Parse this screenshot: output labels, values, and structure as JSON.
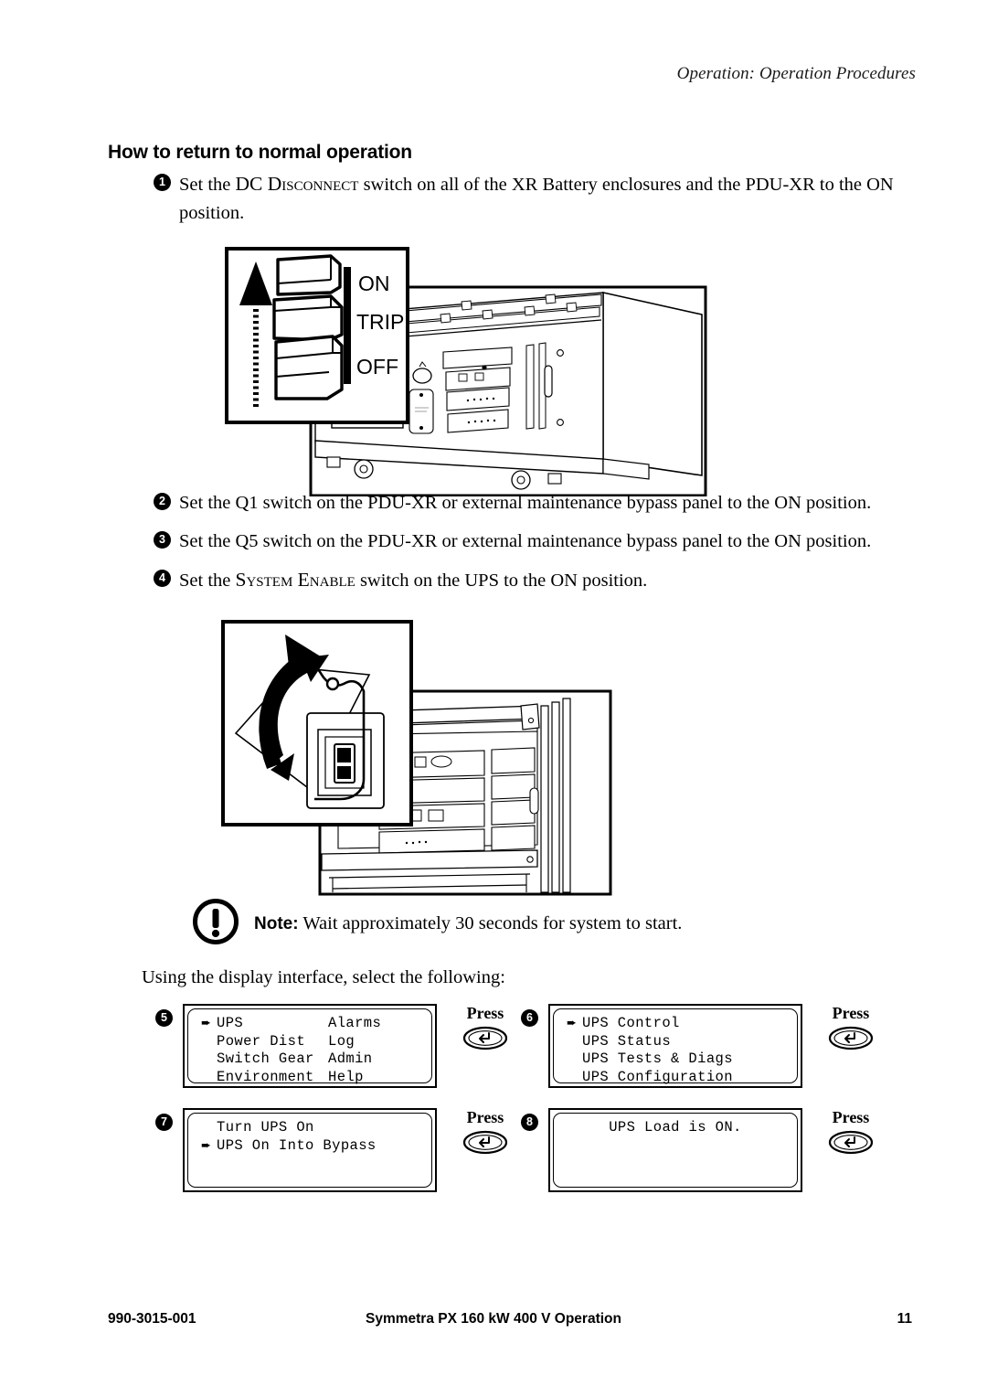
{
  "header": {
    "running_head": "Operation: Operation Procedures"
  },
  "section": {
    "title": "How to return to normal operation"
  },
  "steps": [
    {
      "number": "1",
      "lead": "Set the ",
      "smallcaps": "DC Disconnect",
      "rest": " switch on all of the XR Battery enclosures and the PDU-XR to the ON position."
    },
    {
      "number": "2",
      "text": "Set the Q1 switch on the PDU-XR or external maintenance bypass panel to the ON position."
    },
    {
      "number": "3",
      "text": "Set the Q5 switch on the PDU-XR or external maintenance bypass panel to the ON position."
    },
    {
      "number": "4",
      "lead": "Set the ",
      "smallcaps": "System Enable",
      "rest": " switch on the UPS to the ON position."
    }
  ],
  "figure1": {
    "name": "dc-disconnect-switch-illustration",
    "callout_labels": [
      "ON",
      "TRIP",
      "OFF"
    ],
    "description": "DC Disconnect breaker handle detail with upward arrow, shown on PDU-XR cabinet front"
  },
  "figure2": {
    "name": "system-enable-switch-illustration",
    "description": "System Enable rocker switch behind hinged cover with rotating arrow, shown on UPS frame"
  },
  "note": {
    "label": "Note:",
    "text": " Wait approximately 30 seconds for system to start."
  },
  "display_intro": "Using the display interface, select the following:",
  "press": {
    "label": "Press",
    "key_icon": "enter-key-icon"
  },
  "lcd_panels": [
    {
      "number": "5",
      "name": "lcd-main-menu",
      "layout": "two-column",
      "rows": [
        {
          "arrow": true,
          "col_a": "UPS",
          "col_b": "Alarms"
        },
        {
          "arrow": false,
          "col_a": "Power Dist",
          "col_b": "Log"
        },
        {
          "arrow": false,
          "col_a": "Switch Gear",
          "col_b": "Admin"
        },
        {
          "arrow": false,
          "col_a": "Environment",
          "col_b": "Help"
        }
      ]
    },
    {
      "number": "6",
      "name": "lcd-ups-menu",
      "layout": "single-column",
      "rows": [
        {
          "arrow": true,
          "text": "UPS Control"
        },
        {
          "arrow": false,
          "text": "UPS Status"
        },
        {
          "arrow": false,
          "text": "UPS Tests & Diags"
        },
        {
          "arrow": false,
          "text": "UPS Configuration"
        }
      ]
    },
    {
      "number": "7",
      "name": "lcd-ups-control-menu",
      "layout": "single-column",
      "rows": [
        {
          "arrow": false,
          "text": "Turn UPS On"
        },
        {
          "arrow": true,
          "text": "UPS On Into Bypass"
        },
        {
          "arrow": false,
          "text": ""
        },
        {
          "arrow": false,
          "text": ""
        }
      ]
    },
    {
      "number": "8",
      "name": "lcd-ups-load-status",
      "layout": "centered",
      "rows": [
        {
          "arrow": false,
          "text": ""
        },
        {
          "arrow": false,
          "text": "UPS Load is ON."
        },
        {
          "arrow": false,
          "text": ""
        },
        {
          "arrow": false,
          "text": ""
        }
      ]
    }
  ],
  "footer": {
    "doc_number": "990-3015-001",
    "title": "Symmetra PX 160 kW 400 V Operation",
    "page_number": "11"
  }
}
